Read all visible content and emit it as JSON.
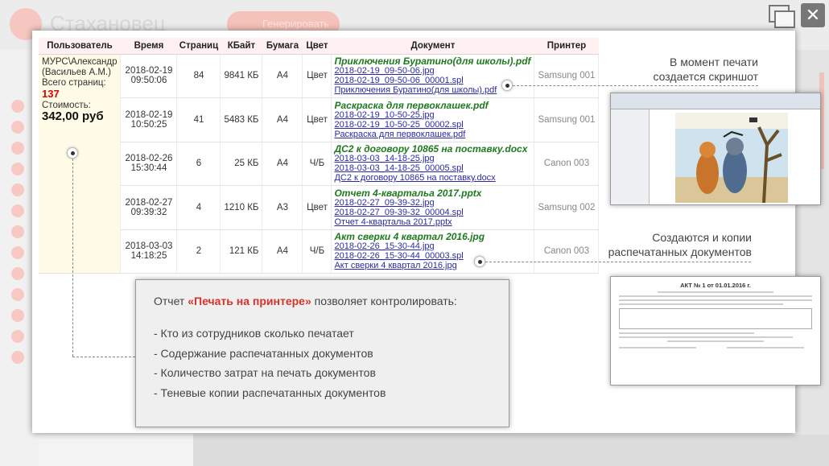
{
  "background": {
    "brand": "Стахановец",
    "generate_button": "Генерировать"
  },
  "table": {
    "headers": [
      "Пользователь",
      "Время",
      "Страниц",
      "КБайт",
      "Бумага",
      "Цвет",
      "Документ",
      "Принтер"
    ],
    "user": {
      "login": "МУРС\\Александр",
      "name": "(Васильев А.М.)",
      "pages_label": "Всего страниц:",
      "pages_total": "137",
      "cost_label": "Стоимость:",
      "cost_total": "342,00 руб"
    },
    "rows": [
      {
        "date": "2018-02-19",
        "time": "09:50:06",
        "pages": "84",
        "kb": "9841 КБ",
        "paper": "А4",
        "color": "Цвет",
        "doc_title": "Приключения Буратино(для школы).pdf",
        "link1": "2018-02-19_09-50-06.jpg",
        "link2": "2018-02-19_09-50-06_00001.spl",
        "link3": "Приключения Буратино(для школы).pdf",
        "printer": "Samsung 001"
      },
      {
        "date": "2018-02-19",
        "time": "10:50:25",
        "pages": "41",
        "kb": "5483 КБ",
        "paper": "А4",
        "color": "Цвет",
        "doc_title": "Раскраска для первоклашек.pdf",
        "link1": "2018-02-19_10-50-25.jpg",
        "link2": "2018-02-19_10-50-25_00002.spl",
        "link3": "Раскраска для первоклашек.pdf",
        "printer": "Samsung 001"
      },
      {
        "date": "2018-02-26",
        "time": "15:30:44",
        "pages": "6",
        "kb": "25 КБ",
        "paper": "А4",
        "color": "Ч/Б",
        "doc_title": "ДС2 к договору 10865 на поставку.docx",
        "link1": "2018-03-03_14-18-25.jpg",
        "link2": "2018-03-03_14-18-25_00005.spl",
        "link3": "ДС2 к договору 10865 на поставку.docx",
        "printer": "Canon 003"
      },
      {
        "date": "2018-02-27",
        "time": "09:39:32",
        "pages": "4",
        "kb": "1210 КБ",
        "paper": "А3",
        "color": "Цвет",
        "doc_title": "Отчет 4-квартальа 2017.pptx",
        "link1": "2018-02-27_09-39-32.jpg",
        "link2": "2018-02-27_09-39-32_00004.spl",
        "link3": "Отчет 4-квартальа 2017.pptx",
        "printer": "Samsung 002"
      },
      {
        "date": "2018-03-03",
        "time": "14:18:25",
        "pages": "2",
        "kb": "121 КБ",
        "paper": "А4",
        "color": "Ч/Б",
        "doc_title": "Акт сверки 4 квартал 2016.jpg",
        "link1": "2018-02-26_15-30-44.jpg",
        "link2": "2018-02-26_15-30-44_00003.spl",
        "link3": "Акт сверки 4 квартал 2016.jpg",
        "printer": "Canon 003"
      }
    ]
  },
  "callouts": {
    "screenshot_line1": "В момент печати",
    "screenshot_line2": "создается скриншот",
    "copies_line1": "Создаются и копии",
    "copies_line2": "распечатанных документов"
  },
  "act_doc": {
    "title": "АКТ № 1 от 01.01.2016 г."
  },
  "info": {
    "intro_before": "Отчет ",
    "intro_highlight": "«Печать на принтере»",
    "intro_after": " позволяет контролировать:",
    "items": [
      "- Кто из сотрудников сколько печатает",
      "- Содержание распечатанных документов",
      "- Количество затрат на печать документов",
      "- Теневые копии распечатанных документов"
    ]
  },
  "colors": {
    "accent_red": "#d7322a",
    "doc_title_green": "#1f7a1f",
    "link_blue": "#2a2aa8",
    "header_bg": "#fff1f1",
    "user_bg": "#fffbe6"
  }
}
